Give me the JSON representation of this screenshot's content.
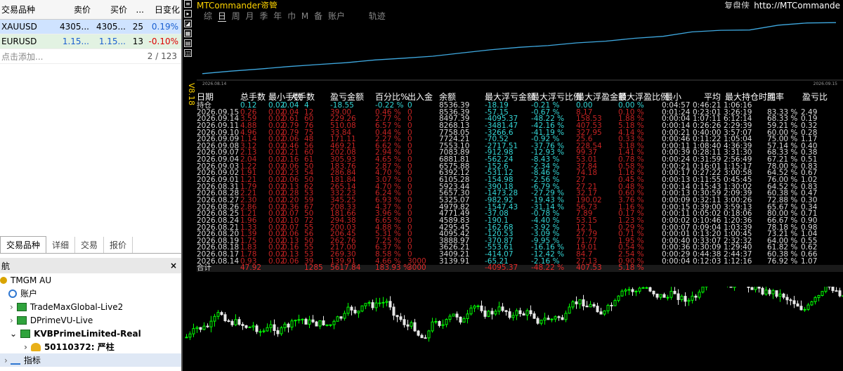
{
  "market_watch": {
    "headers": [
      "交易品种",
      "卖价",
      "买价",
      "...",
      "日变化"
    ],
    "rows": [
      {
        "symbol": "XAUUSD",
        "bid": "4305...",
        "ask": "4305...",
        "spread": "25",
        "change": "0.19%"
      },
      {
        "symbol": "EURUSD",
        "bid": "1.15...",
        "ask": "1.15...",
        "spread": "13",
        "change": "-0.10%"
      }
    ],
    "add_label": "点击添加...",
    "count": "2 / 123",
    "tabs": [
      "交易品种",
      "详细",
      "交易",
      "报价"
    ]
  },
  "navigator": {
    "title": "航",
    "close": "×",
    "items": [
      "TMGM AU",
      "账户",
      "TradeMaxGlobal-Live2",
      "DPrimeVU-Live",
      "KVBPrimeLimited-Real",
      "50110372: 严柱",
      "指标"
    ]
  },
  "chart": {
    "title": "MTCommander资管",
    "header_right_label": "复盘侠",
    "header_link": "http://MTCommande",
    "vertical_label": "V8.18",
    "nav_items": [
      "综",
      "日",
      "周",
      "月",
      "季",
      "年",
      "巾",
      "M",
      "备",
      "账户",
      "轨迹"
    ],
    "active_nav": "日",
    "date_start": "2026.08.14",
    "date_end": "2026.09.15",
    "equity_color": "#3fa9e0"
  },
  "table": {
    "headers": [
      "日期",
      "总手数",
      "最小手数",
      "大手数",
      "盈亏金额",
      "百分比%",
      "出入金",
      "余额",
      "最大浮亏金额",
      "最大浮亏比例",
      "最大浮盈金额",
      "最大浮盈比例",
      "最小",
      "平均",
      "最大持仓时间",
      "胜率",
      "盈亏比"
    ],
    "hold_row": [
      "持仓",
      "0.12",
      "0.02",
      "0.04",
      "4",
      "-18.55",
      "-0.22 %",
      "0",
      "8536.39",
      "-18.19",
      "-0.21 %",
      "0.00",
      "0.00 %",
      "0:04:57",
      "0:46:21",
      "1:06:16",
      "",
      ""
    ],
    "rows": [
      [
        "2026.09.15",
        "0.26",
        "0.02",
        "0.04",
        "12",
        "39.00",
        "0.46 %",
        "0",
        "8536.39",
        "-57.15",
        "-0.67 %",
        "8.17",
        "0.10 %",
        "0:01:24",
        "0:23:01",
        "3:26:19",
        "83.33 %",
        "2.49"
      ],
      [
        "2026.09.14",
        "3.59",
        "0.02",
        "0.61",
        "60",
        "229.26",
        "2.77 %",
        "0",
        "8497.39",
        "-4095.37",
        "-48.22 %",
        "158.53",
        "1.88 %",
        "0:00:04",
        "1:07:11",
        "6:12:14",
        "68.33 %",
        "0.19"
      ],
      [
        "2026.09.11",
        "4.88",
        "0.02",
        "0.79",
        "76",
        "510.08",
        "6.57 %",
        "0",
        "8268.13",
        "-3481.47",
        "-42.16 %",
        "407.53",
        "5.18 %",
        "0:00:14",
        "0:26:26",
        "2:29:39",
        "59.21 %",
        "0.32"
      ],
      [
        "2026.09.10",
        "4.96",
        "0.02",
        "0.79",
        "75",
        "33.84",
        "0.44 %",
        "0",
        "7758.05",
        "-3266.6",
        "-41.19 %",
        "327.95",
        "4.14 %",
        "0:00:21",
        "0:40:00",
        "3:57:07",
        "60.00 %",
        "0.28"
      ],
      [
        "2026.09.09",
        "1.14",
        "0.02",
        "0.06",
        "48",
        "171.11",
        "2.27 %",
        "0",
        "7724.21",
        "-70.52",
        "-0.92 %",
        "25.6",
        "0.33 %",
        "0:00:46",
        "0:11:22",
        "1:05:04",
        "75.00 %",
        "1.17"
      ],
      [
        "2026.09.08",
        "3.12",
        "0.02",
        "0.46",
        "56",
        "469.21",
        "6.62 %",
        "0",
        "7553.10",
        "-2717.51",
        "-37.76 %",
        "228.54",
        "3.18 %",
        "0:00:11",
        "1:08:40",
        "4:36:39",
        "57.14 %",
        "0.40"
      ],
      [
        "2026.09.07",
        "2.13",
        "0.02",
        "0.21",
        "60",
        "202.08",
        "2.94 %",
        "0",
        "7083.89",
        "-912.98",
        "-12.93 %",
        "99.37",
        "1.41 %",
        "0:00:39",
        "0:28:11",
        "3:31:30",
        "68.33 %",
        "0.38"
      ],
      [
        "2026.09.04",
        "2.04",
        "0.02",
        "0.16",
        "61",
        "305.93",
        "4.65 %",
        "0",
        "6881.81",
        "-562.24",
        "-8.43 %",
        "53.01",
        "0.78 %",
        "0:00:24",
        "0:31:59",
        "2:56:49",
        "67.21 %",
        "0.51"
      ],
      [
        "2026.09.03",
        "1.22",
        "0.02",
        "0.06",
        "50",
        "183.76",
        "2.87 %",
        "0",
        "6575.88",
        "-152.6",
        "-2.34 %",
        "37.84",
        "0.58 %",
        "0:00:21",
        "0:16:01",
        "1:15:17",
        "78.00 %",
        "0.83"
      ],
      [
        "2026.09.02",
        "1.91",
        "0.02",
        "0.23",
        "54",
        "286.84",
        "4.70 %",
        "0",
        "6392.12",
        "-531.12",
        "-8.46 %",
        "74.18",
        "1.16 %",
        "0:00:17",
        "0:27:22",
        "3:00:58",
        "64.52 %",
        "0.67"
      ],
      [
        "2026.09.01",
        "1.21",
        "0.02",
        "0.06",
        "50",
        "181.84",
        "3.07 %",
        "0",
        "6105.28",
        "-154.98",
        "-2.56 %",
        "27",
        "0.45 %",
        "0:00:13",
        "0:11:55",
        "0:45:45",
        "76.00 %",
        "1.02"
      ],
      [
        "2026.08.31",
        "1.79",
        "0.02",
        "0.13",
        "62",
        "265.14",
        "4.70 %",
        "0",
        "5923.44",
        "-390.18",
        "-6.79 %",
        "27.21",
        "0.48 %",
        "0:00:14",
        "0:15:43",
        "1:30:02",
        "64.52 %",
        "0.83"
      ],
      [
        "2026.08.28",
        "2.21",
        "0.02",
        "0.28",
        "53",
        "332.23",
        "6.24 %",
        "0",
        "5657.30",
        "-1473.28",
        "-27.29 %",
        "32.17",
        "0.60 %",
        "0:00:13",
        "0:30:59",
        "2:09:39",
        "60.38 %",
        "0.47"
      ],
      [
        "2026.08.27",
        "2.30",
        "0.02",
        "0.20",
        "59",
        "345.25",
        "6.93 %",
        "0",
        "5325.07",
        "-982.92",
        "-19.43 %",
        "190.02",
        "3.76 %",
        "0:00:09",
        "0:32:11",
        "3:00:26",
        "72.88 %",
        "0.30"
      ],
      [
        "2026.08.26",
        "2.86",
        "0.02",
        "0.36",
        "67",
        "208.33",
        "4.37 %",
        "0",
        "4979.82",
        "-1547.43",
        "-31.14 %",
        "56.73",
        "1.16 %",
        "0:00:15",
        "0:39:00",
        "3:59:13",
        "65.67 %",
        "0.34"
      ],
      [
        "2026.08.25",
        "1.21",
        "0.02",
        "0.07",
        "50",
        "181.66",
        "3.96 %",
        "0",
        "4771.49",
        "-37.08",
        "-0.78 %",
        "7.89",
        "0.17 %",
        "0:00:11",
        "0:05:02",
        "0:18:06",
        "80.00 %",
        "0.71"
      ],
      [
        "2026.08.24",
        "1.96",
        "0.02",
        "0.10",
        "72",
        "294.38",
        "6.65 %",
        "0",
        "4589.83",
        "-190.1",
        "-4.40 %",
        "53.15",
        "1.23 %",
        "0:00:02",
        "0:10:46",
        "1:20:36",
        "66.67 %",
        "0.90"
      ],
      [
        "2026.08.21",
        "1.33",
        "0.02",
        "0.07",
        "55",
        "200.03",
        "4.88 %",
        "0",
        "4295.45",
        "-162.68",
        "-3.92 %",
        "12.1",
        "0.29 %",
        "0:00:07",
        "0:09:04",
        "1:03:39",
        "78.18 %",
        "0.98"
      ],
      [
        "2026.08.20",
        "1.39",
        "0.02",
        "0.06",
        "56",
        "206.45",
        "5.31 %",
        "0",
        "4095.42",
        "-120.53",
        "-3.09 %",
        "27.79",
        "0.71 %",
        "0:00:01",
        "0:13:20",
        "1:00:45",
        "73.21 %",
        "1.04"
      ],
      [
        "2026.08.19",
        "1.75",
        "0.02",
        "0.13",
        "50",
        "262.76",
        "7.25 %",
        "0",
        "3888.97",
        "-370.87",
        "-9.95 %",
        "71.77",
        "1.95 %",
        "0:00:40",
        "0:33:07",
        "2:32:32",
        "64.00 %",
        "0.55"
      ],
      [
        "2026.08.18",
        "1.83",
        "0.02",
        "0.16",
        "55",
        "217.00",
        "6.37 %",
        "0",
        "3626.21",
        "-553.61",
        "-16.16 %",
        "19.01",
        "0.54 %",
        "0:00:36",
        "0:30:09",
        "1:29:40",
        "61.82 %",
        "0.62"
      ],
      [
        "2026.08.17",
        "1.78",
        "0.02",
        "0.13",
        "53",
        "269.30",
        "8.58 %",
        "0",
        "3409.21",
        "-414.07",
        "-12.42 %",
        "84.7",
        "2.54 %",
        "0:00:29",
        "0:44:38",
        "2:44:37",
        "60.38 %",
        "0.66"
      ],
      [
        "2026.08.14",
        "0.93",
        "0.02",
        "0.06",
        "39",
        "139.91",
        "4.66 %",
        "3000",
        "3139.91",
        "-65.21",
        "-2.16 %",
        "27.13",
        "0.90 %",
        "0:00:04",
        "0:12:03",
        "1:12:16",
        "76.92 %",
        "1.07"
      ]
    ],
    "total_row": [
      "合计",
      "47.92",
      "",
      "",
      "1285",
      "5617.84",
      "183.93 %",
      "3000",
      "",
      "-4095.37",
      "-48.22 %",
      "407.53",
      "5.18 %",
      "",
      "",
      "",
      "",
      ""
    ]
  }
}
